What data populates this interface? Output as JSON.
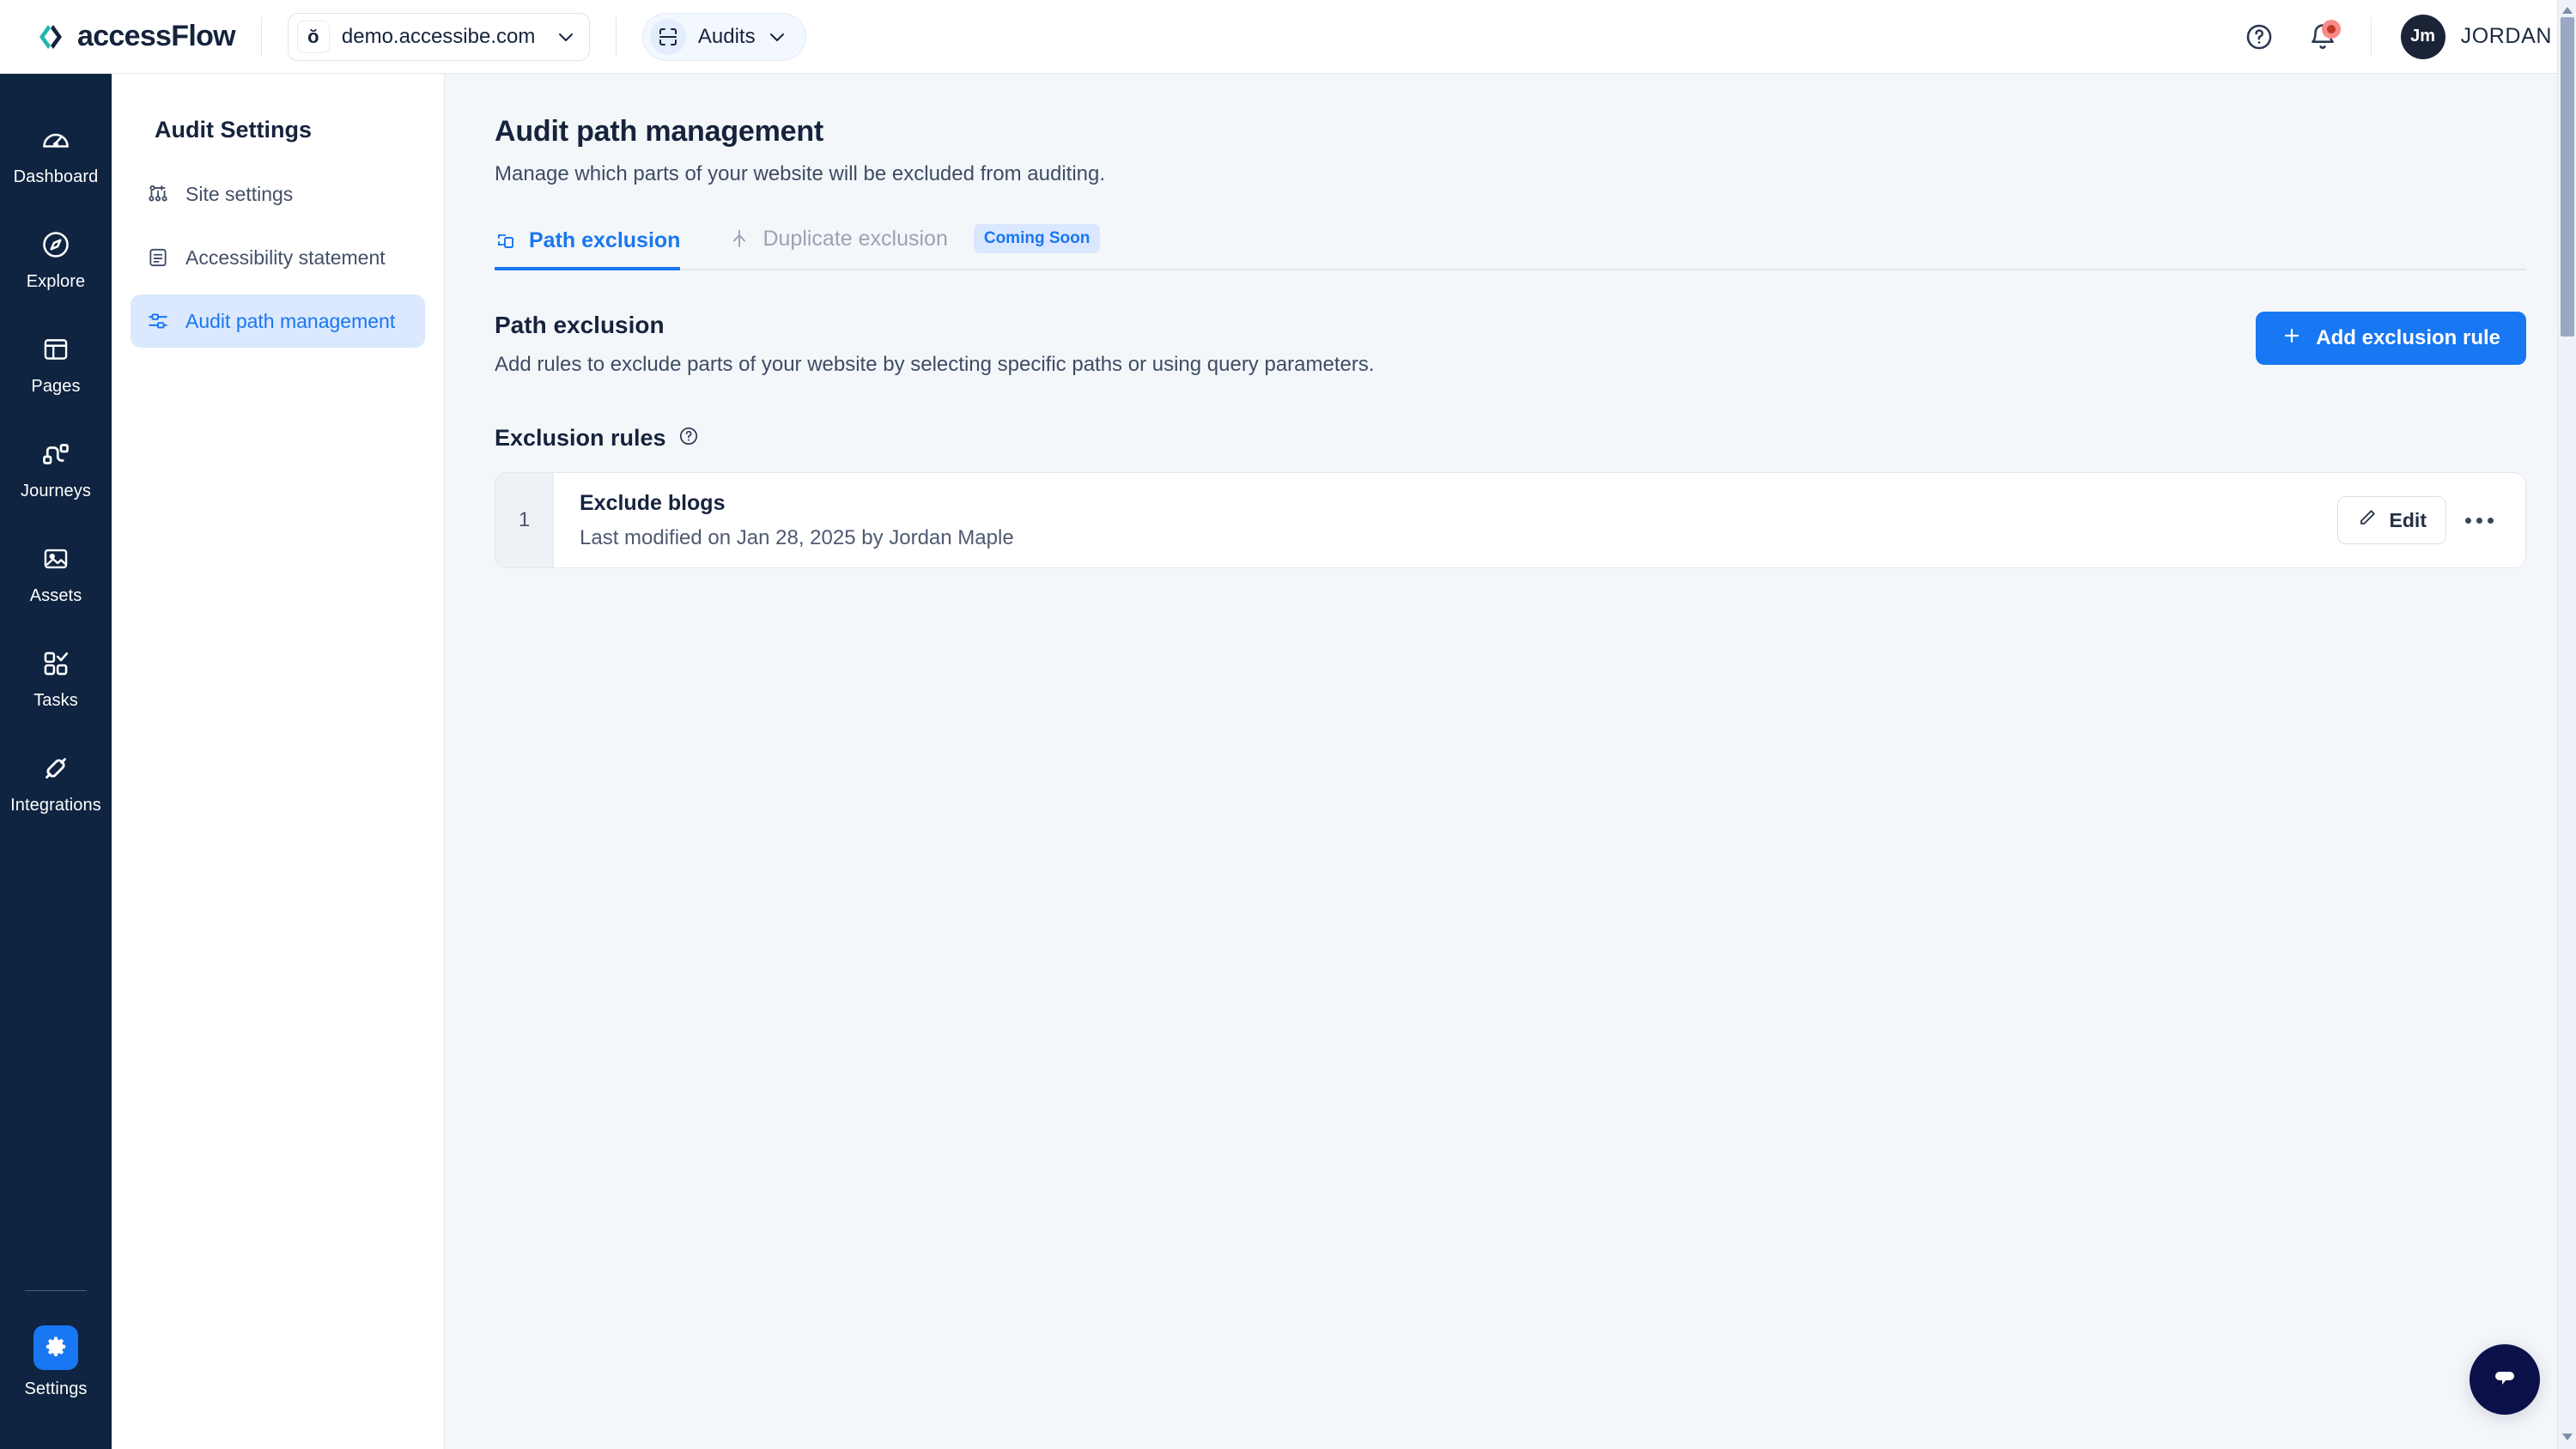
{
  "topbar": {
    "brand_name": "accessFlow",
    "brand_logo_icon": "accessflow-logo-icon",
    "site_selector": {
      "favicon_glyph": "ŏ",
      "value": "demo.accessibe.com",
      "chevron_icon": "chevron-down-icon"
    },
    "scope_selector": {
      "icon": "scan-audit-icon",
      "label": "Audits",
      "chevron_icon": "chevron-down-icon"
    },
    "help_icon": "help-circle-icon",
    "notifications_icon": "bell-icon",
    "notifications_has_unread": true,
    "user": {
      "initials": "Jm",
      "name": "JORDAN"
    }
  },
  "rail": {
    "items": [
      {
        "label": "Dashboard",
        "icon": "gauge-icon",
        "active": false
      },
      {
        "label": "Explore",
        "icon": "compass-icon",
        "active": false
      },
      {
        "label": "Pages",
        "icon": "layout-icon",
        "active": false
      },
      {
        "label": "Journeys",
        "icon": "journey-nodes-icon",
        "active": false
      },
      {
        "label": "Assets",
        "icon": "image-icon",
        "active": false
      },
      {
        "label": "Tasks",
        "icon": "checklist-squares-icon",
        "active": false
      },
      {
        "label": "Integrations",
        "icon": "plug-icon",
        "active": false
      }
    ],
    "bottom_item": {
      "label": "Settings",
      "icon": "gear-icon",
      "active": true
    }
  },
  "subnav": {
    "title": "Audit Settings",
    "items": [
      {
        "label": "Site settings",
        "icon": "site-settings-icon",
        "active": false
      },
      {
        "label": "Accessibility statement",
        "icon": "document-lines-icon",
        "active": false
      },
      {
        "label": "Audit path management",
        "icon": "path-sliders-icon",
        "active": true
      }
    ]
  },
  "main": {
    "page_title": "Audit path management",
    "page_subtitle": "Manage which parts of your website will be excluded from auditing.",
    "tabs": [
      {
        "label": "Path exclusion",
        "icon": "dashed-square-icon",
        "active": true,
        "badge": null
      },
      {
        "label": "Duplicate exclusion",
        "icon": "merge-branch-icon",
        "active": false,
        "badge": "Coming Soon"
      }
    ],
    "section": {
      "title": "Path exclusion",
      "subtitle": "Add rules to exclude parts of your website by selecting specific paths or using query parameters.",
      "add_button": {
        "label": "Add exclusion rule",
        "icon": "plus-icon"
      }
    },
    "rules_header": {
      "label": "Exclusion rules",
      "info_icon": "help-circle-icon"
    },
    "rules": [
      {
        "number": "1",
        "name": "Exclude blogs",
        "meta": "Last modified on Jan 28, 2025 by Jordan Maple",
        "edit_label": "Edit",
        "edit_icon": "pencil-icon",
        "more_icon": "ellipsis-icon"
      }
    ]
  },
  "chat": {
    "icon": "chat-bubble-icon"
  },
  "colors": {
    "accent": "#1877f2",
    "rail_bg": "#0f2440",
    "page_bg": "#f4f7fa",
    "badge_bg": "#dbe7ff",
    "notification": "#c0392b"
  }
}
